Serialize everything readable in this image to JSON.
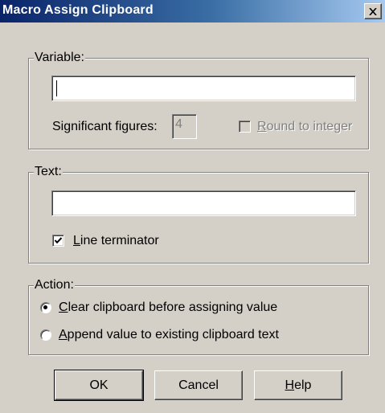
{
  "window": {
    "title": "Macro Assign Clipboard",
    "close_glyph": "✕"
  },
  "variable_group": {
    "legend": "Variable:",
    "input_value": "",
    "sig_figs_label": "Significant figures:",
    "sig_figs_value": "4",
    "round_mnemonic": "R",
    "round_rest": "ound to integer",
    "round_checked": false,
    "round_enabled": false
  },
  "text_group": {
    "legend": "Text:",
    "input_value": "",
    "line_term_mnemonic": "L",
    "line_term_rest": "ine terminator",
    "line_term_checked": true
  },
  "action_group": {
    "legend": "Action:",
    "options": [
      {
        "mnemonic": "C",
        "rest": "lear clipboard before assigning value",
        "selected": true
      },
      {
        "mnemonic": "A",
        "rest": "ppend value to existing clipboard text",
        "selected": false
      }
    ]
  },
  "buttons": {
    "ok": "OK",
    "cancel": "Cancel",
    "help_mnemonic": "H",
    "help_rest": "elp"
  },
  "colors": {
    "face": "#d4d0c8",
    "title_start": "#0a246a",
    "title_end": "#a6caf0",
    "disabled_text": "#808080"
  }
}
